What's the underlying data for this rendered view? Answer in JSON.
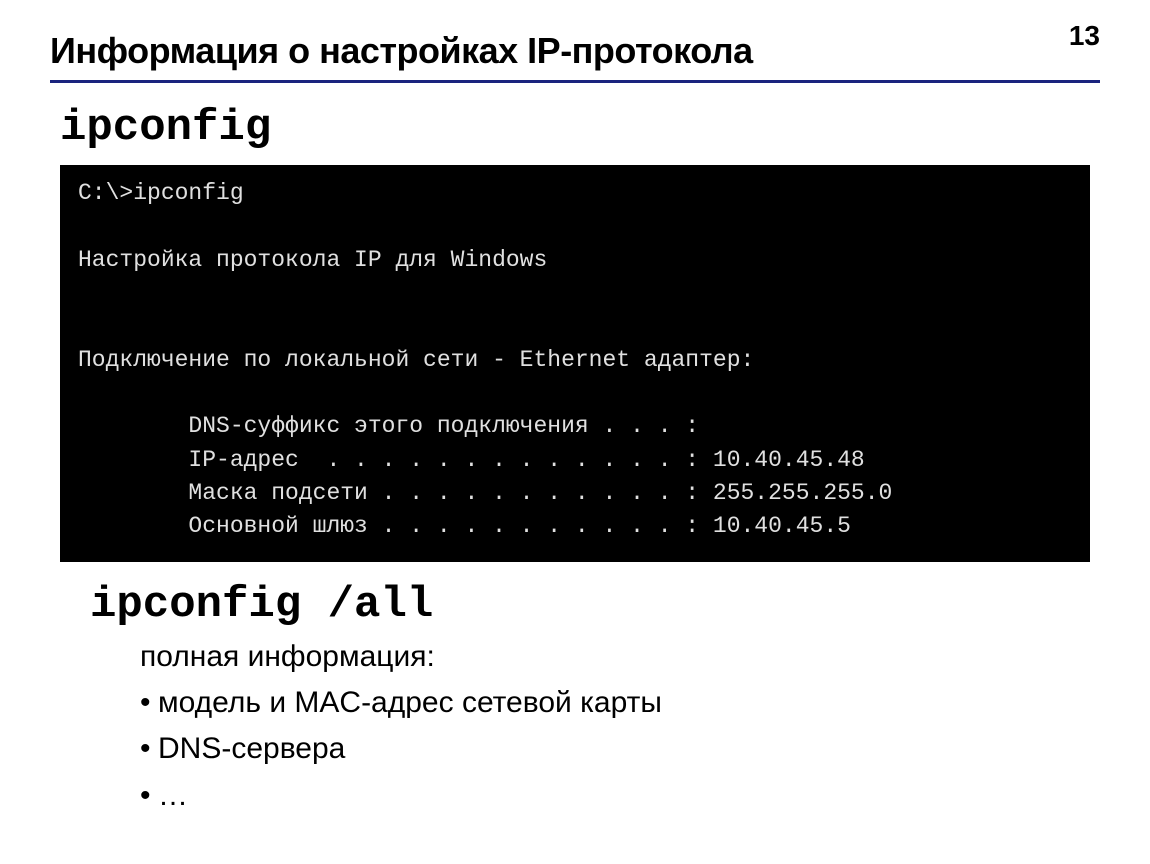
{
  "page_number": "13",
  "title": "Информация о настройках IP-протокола",
  "command1": "ipconfig",
  "terminal": {
    "line1": "C:\\>ipconfig",
    "line2": "Настройка протокола IP для Windows",
    "line3": "Подключение по локальной сети - Ethernet адаптер:",
    "line4": "        DNS-суффикс этого подключения . . . :",
    "line5": "        IP-адрес  . . . . . . . . . . . . . : 10.40.45.48",
    "line6": "        Маска подсети . . . . . . . . . . . : 255.255.255.0",
    "line7": "        Основной шлюз . . . . . . . . . . . : 10.40.45.5"
  },
  "command2": "ipconfig /all",
  "info_intro": "полная информация:",
  "bullets": {
    "item1": "модель и MAC-адрес сетевой карты",
    "item2": "DNS-сервера",
    "item3": "…"
  }
}
